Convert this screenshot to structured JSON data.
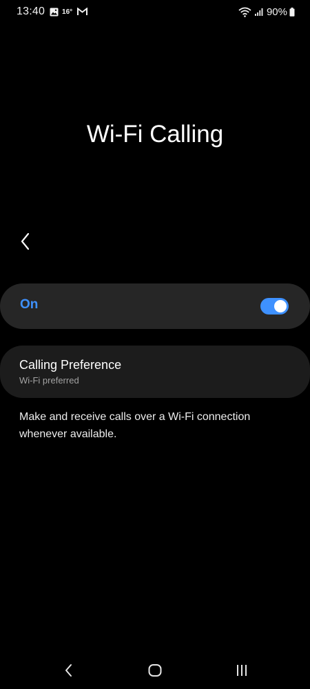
{
  "status_bar": {
    "time": "13:40",
    "temperature": "16°",
    "battery": "90%",
    "icons": [
      "gallery-icon",
      "gmail-icon",
      "wifi-icon",
      "signal-icon",
      "battery-icon"
    ]
  },
  "page": {
    "title": "Wi-Fi Calling",
    "back_icon": "chevron-left-icon"
  },
  "toggle": {
    "label": "On",
    "state": true,
    "accent_color": "#3e91ff"
  },
  "calling_preference": {
    "title": "Calling Preference",
    "value": "Wi-Fi preferred"
  },
  "description": "Make and receive calls over a Wi-Fi connection whenever available.",
  "nav_bar": {
    "buttons": [
      "back-icon",
      "home-icon",
      "recents-icon"
    ]
  }
}
